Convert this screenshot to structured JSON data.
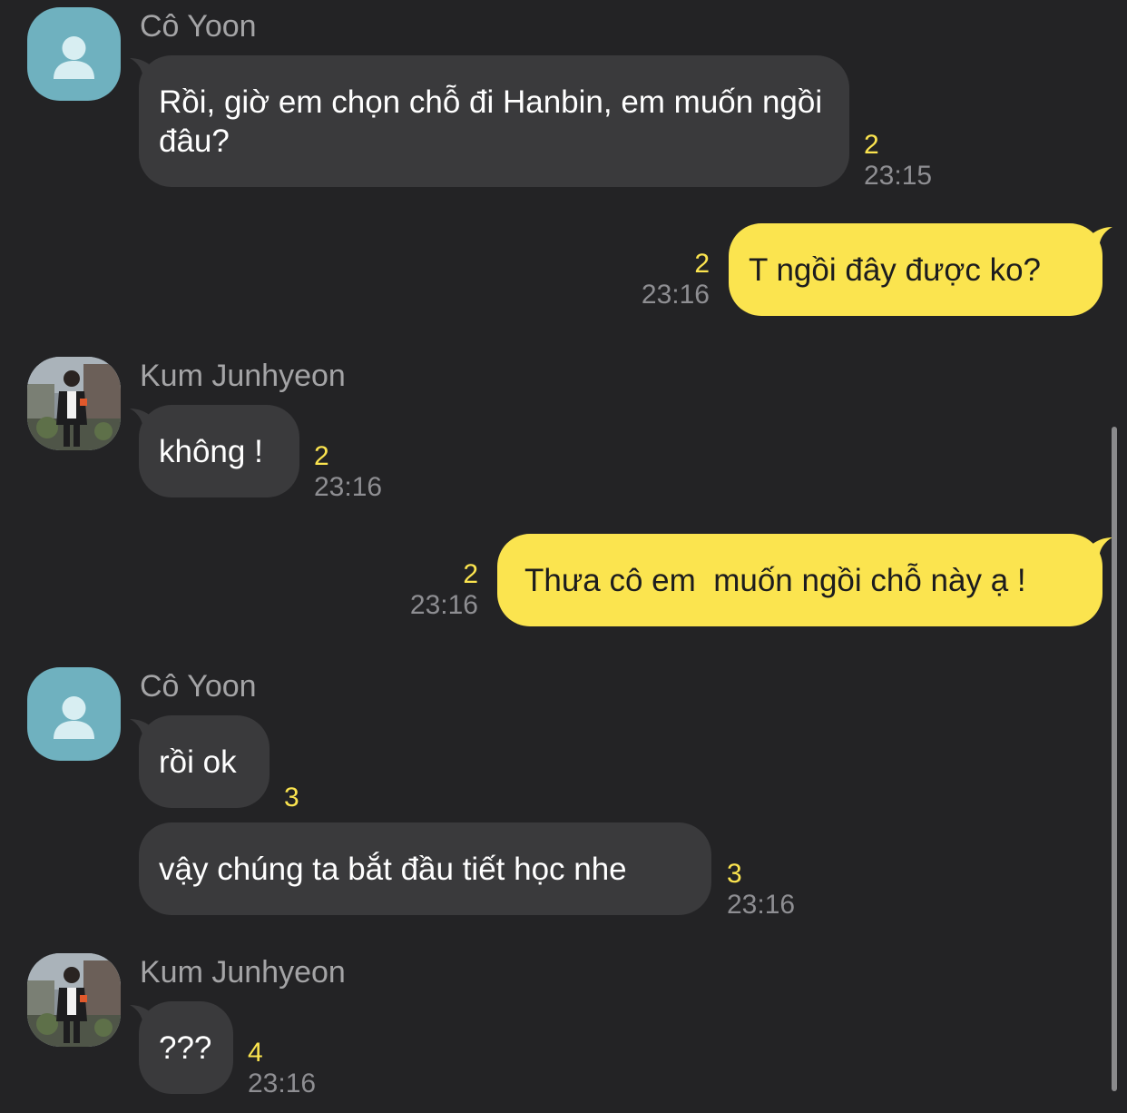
{
  "chat": {
    "messages": [
      {
        "sender": "Cô Yoon",
        "text": "Rồi, giờ em chọn chỗ đi Hanbin, em muốn ngồi đâu?",
        "unread": "2",
        "time": "23:15"
      },
      {
        "sender": "",
        "text": "T ngồi đây được ko?",
        "unread": "2",
        "time": "23:16"
      },
      {
        "sender": "Kum Junhyeon",
        "text": "không !",
        "unread": "2",
        "time": "23:16"
      },
      {
        "sender": "",
        "text": "Thưa cô em  muốn ngồi chỗ này ạ !",
        "unread": "2",
        "time": "23:16"
      },
      {
        "sender": "Cô Yoon",
        "text": "rồi ok",
        "unread": "3",
        "time": ""
      },
      {
        "sender": "",
        "text": "vậy chúng ta bắt đầu tiết học nhe",
        "unread": "3",
        "time": "23:16"
      },
      {
        "sender": "Kum Junhyeon",
        "text": "???",
        "unread": "4",
        "time": "23:16"
      }
    ]
  },
  "icons": {
    "default_avatar": "person-silhouette-icon",
    "photo_avatar": "profile-photo"
  },
  "colors": {
    "background": "#232325",
    "incoming_bubble": "#3a3a3c",
    "outgoing_bubble": "#fbe44f",
    "unread_count": "#fbe44f",
    "timestamp": "#8e8e92",
    "sender_name": "#a4a4a6",
    "default_avatar_bg": "#6fb1bf"
  }
}
